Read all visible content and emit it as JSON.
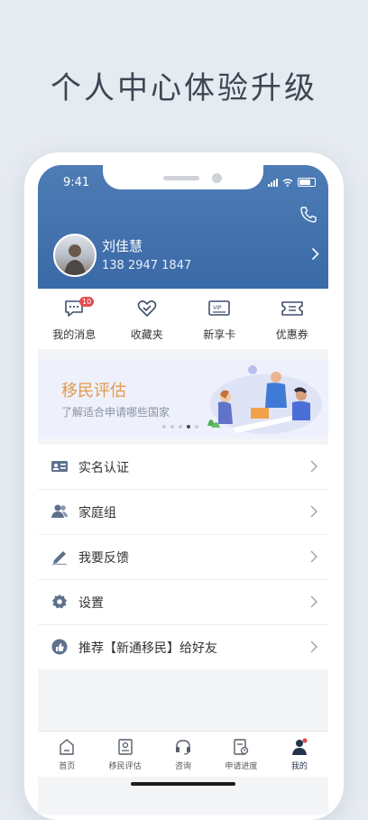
{
  "headline": "个人中心体验升级",
  "status_bar": {
    "time": "9:41"
  },
  "profile": {
    "name": "刘佳慧",
    "phone": "138 2947 1847"
  },
  "quick_actions": [
    {
      "label": "我的消息",
      "badge": "10",
      "icon": "message-icon"
    },
    {
      "label": "收藏夹",
      "icon": "heart-icon"
    },
    {
      "label": "新享卡",
      "icon": "vip-card-icon"
    },
    {
      "label": "优惠券",
      "icon": "coupon-icon"
    }
  ],
  "banner": {
    "title": "移民评估",
    "subtitle": "了解适合申请哪些国家"
  },
  "menu": [
    {
      "label": "实名认证",
      "icon": "id-card-icon"
    },
    {
      "label": "家庭组",
      "icon": "family-icon"
    },
    {
      "label": "我要反馈",
      "icon": "pencil-icon"
    },
    {
      "label": "设置",
      "icon": "gear-icon"
    },
    {
      "label": "推荐【新通移民】给好友",
      "icon": "thumbs-up-icon"
    }
  ],
  "tabs": [
    {
      "label": "首页",
      "icon": "home-icon"
    },
    {
      "label": "移民评估",
      "icon": "assessment-icon"
    },
    {
      "label": "咨询",
      "icon": "headset-icon"
    },
    {
      "label": "申请进度",
      "icon": "progress-icon"
    },
    {
      "label": "我的",
      "icon": "user-icon",
      "active": true
    }
  ],
  "colors": {
    "header": "#4a78b2",
    "accent": "#e39a4b",
    "badge": "#e24d4d",
    "icon": "#5a6a85"
  }
}
